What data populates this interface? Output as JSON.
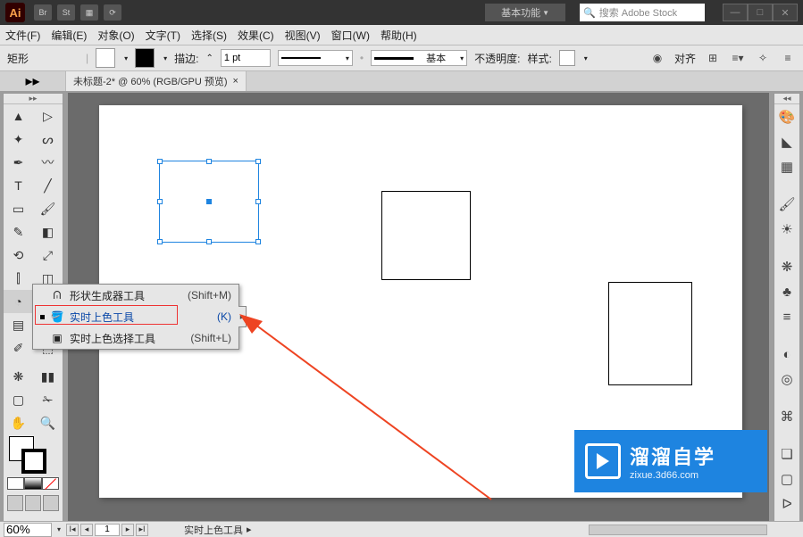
{
  "title_bar": {
    "workspace": "基本功能",
    "search_placeholder": "搜索 Adobe Stock",
    "minimize": "—",
    "maximize": "□",
    "close": "✕",
    "icon_br": "Br",
    "icon_st": "St"
  },
  "menus": [
    "文件(F)",
    "编辑(E)",
    "对象(O)",
    "文字(T)",
    "选择(S)",
    "效果(C)",
    "视图(V)",
    "窗口(W)",
    "帮助(H)"
  ],
  "options": {
    "shape_label": "矩形",
    "stroke_label": "描边:",
    "stroke_value": "1 pt",
    "style_label": "基本",
    "opacity_label": "不透明度:",
    "style2_label": "样式:",
    "align_label": "对齐"
  },
  "doc_tab": {
    "title": "未标题-2* @ 60% (RGB/GPU 预览)",
    "close": "×",
    "expand": "▸▸"
  },
  "flyout": {
    "items": [
      {
        "icon": "shape-builder",
        "label": "形状生成器工具",
        "shortcut": "(Shift+M)",
        "selected": false
      },
      {
        "icon": "live-paint",
        "label": "实时上色工具",
        "shortcut": "(K)",
        "selected": true
      },
      {
        "icon": "live-paint-select",
        "label": "实时上色选择工具",
        "shortcut": "(Shift+L)",
        "selected": false
      }
    ]
  },
  "status": {
    "zoom": "60%",
    "page": "1",
    "tool_label": "实时上色工具"
  },
  "brand": {
    "main": "溜溜自学",
    "sub": "zixue.3d66.com"
  },
  "right_icons": [
    "palette",
    "color-guide",
    "swatches",
    "brushes",
    "symbols",
    "stroke",
    "gradient",
    "transparency",
    "appearance",
    "graphic-styles",
    "layers",
    "artboards",
    "links",
    "cc-libraries"
  ]
}
